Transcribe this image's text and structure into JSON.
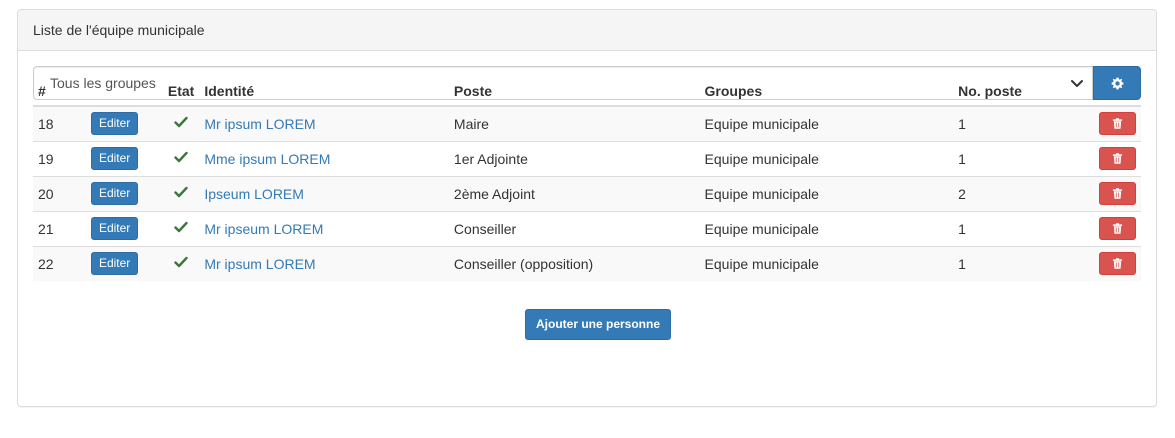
{
  "panel": {
    "title": "Liste de l'équipe municipale"
  },
  "filter": {
    "selected": "Tous les groupes",
    "settings_icon": "gear-icon"
  },
  "table": {
    "headers": [
      "#",
      "",
      "Etat",
      "Identité",
      "Poste",
      "Groupes",
      "No. poste",
      ""
    ],
    "edit_label": "Editer",
    "status_icon": "check-icon",
    "delete_icon": "trash-icon",
    "rows": [
      {
        "id": "18",
        "identity": "Mr ipsum LOREM",
        "poste": "Maire",
        "groupes": "Equipe municipale",
        "no_poste": "1"
      },
      {
        "id": "19",
        "identity": "Mme ipsum LOREM",
        "poste": "1er Adjointe",
        "groupes": "Equipe municipale",
        "no_poste": "1"
      },
      {
        "id": "20",
        "identity": "Ipseum LOREM",
        "poste": "2ème Adjoint",
        "groupes": "Equipe municipale",
        "no_poste": "2"
      },
      {
        "id": "21",
        "identity": "Mr ipseum LOREM",
        "poste": "Conseiller",
        "groupes": "Equipe municipale",
        "no_poste": "1"
      },
      {
        "id": "22",
        "identity": "Mr ipsum LOREM",
        "poste": "Conseiller (opposition)",
        "groupes": "Equipe municipale",
        "no_poste": "1"
      }
    ]
  },
  "actions": {
    "add_label": "Ajouter une personne"
  },
  "colors": {
    "primary": "#337ab7",
    "danger": "#d9534f",
    "success": "#3c763d",
    "link": "#337ab7"
  }
}
